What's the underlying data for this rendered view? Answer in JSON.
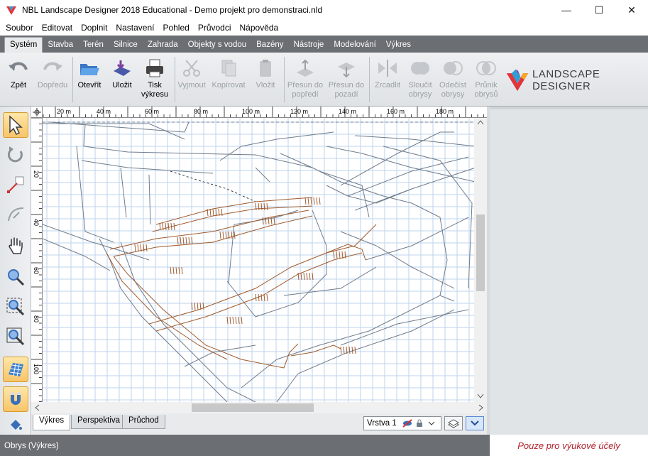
{
  "window": {
    "title": "NBL Landscape Designer 2018 Educational - Demo projekt pro demonstraci.nld",
    "minimize": "—",
    "maximize": "☐",
    "close": "✕"
  },
  "menu": [
    "Soubor",
    "Editovat",
    "Doplnit",
    "Nastavení",
    "Pohled",
    "Průvodci",
    "Nápověda"
  ],
  "ribbon_tabs": [
    "Systém",
    "Stavba",
    "Terén",
    "Silnice",
    "Zahrada",
    "Objekty s vodou",
    "Bazény",
    "Nástroje",
    "Modelování",
    "Výkres"
  ],
  "ribbon_active": "Systém",
  "toolbar": {
    "undo": "Zpět",
    "redo": "Dopředu",
    "open": "Otevřít",
    "save": "Uložit",
    "print_line1": "Tisk",
    "print_line2": "výkresu",
    "cut": "Vyjmout",
    "copy": "Kopírovat",
    "paste": "Vložit",
    "front_line1": "Přesun do",
    "front_line2": "popředí",
    "back_line1": "Přesun do",
    "back_line2": "pozadí",
    "mirror": "Zrcadlit",
    "union_line1": "Sloučit",
    "union_line2": "obrysy",
    "subtract_line1": "Odečíst",
    "subtract_line2": "obrysy",
    "intersect_line1": "Průnik",
    "intersect_line2": "obrysů"
  },
  "brand": {
    "text": "LANDSCAPE DESIGNER",
    "colors": [
      "#e2343c",
      "#2d9fd8",
      "#f5a623",
      "#7b3fa0"
    ]
  },
  "ruler_top": [
    "20 m",
    "40 m",
    "60 m",
    "80 m",
    "100 m",
    "120 m",
    "140 m",
    "160 m",
    "180 m"
  ],
  "ruler_left": [
    "20",
    "40",
    "60",
    "80",
    "100"
  ],
  "bottom_tabs": [
    "Výkres",
    "Perspektiva",
    "Průchod"
  ],
  "bottom_tab_active": "Výkres",
  "layer": {
    "name": "Vrstva 1"
  },
  "status": {
    "left": "Obrys (Výkres)",
    "right": "Pouze pro výukové účely"
  },
  "colors": {
    "grid": "#bcd3ee",
    "outline": "#6f7c8c",
    "path": "#a05a2c",
    "status_text": "#b0222a"
  }
}
